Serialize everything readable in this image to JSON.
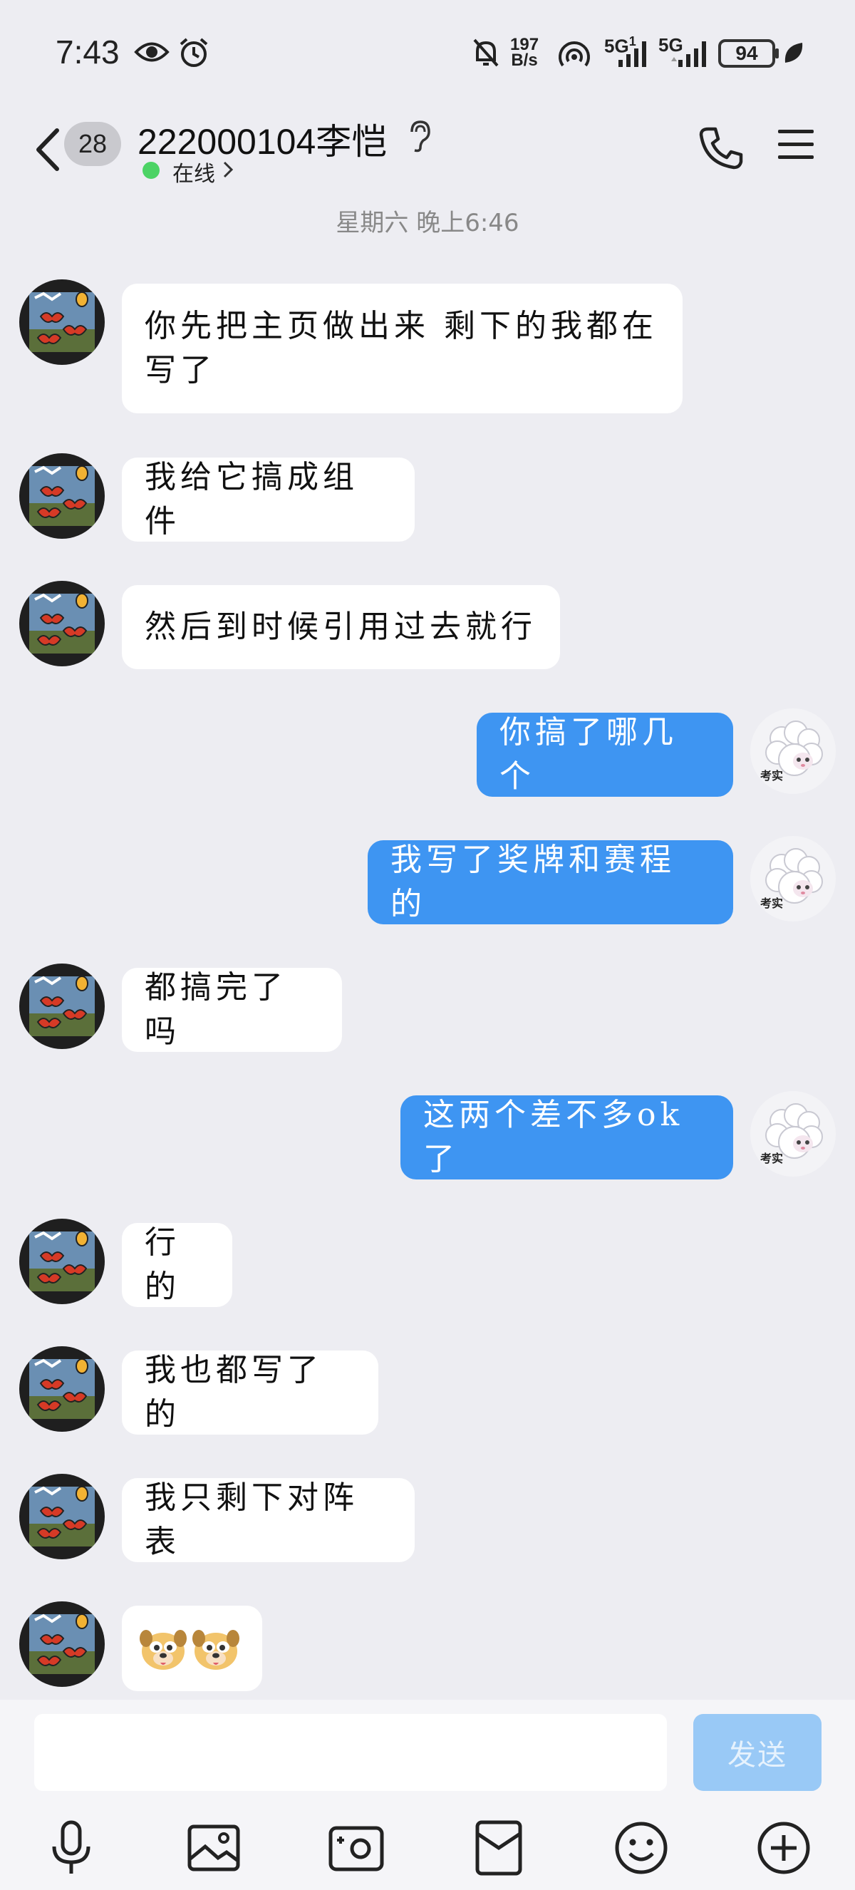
{
  "status_bar": {
    "time": "7:43",
    "net_speed_value": "197",
    "net_speed_unit": "B/s",
    "signal1_label": "5G",
    "signal1_sup": "1",
    "signal2_label": "5G",
    "battery": "94",
    "icons": [
      "eye-icon",
      "alarm-icon",
      "mute-bell-icon",
      "hotspot-icon",
      "signal-icon",
      "signal-icon",
      "battery-icon",
      "leaf-icon"
    ]
  },
  "header": {
    "unread_count": "28",
    "contact_name": "222000104李恺",
    "online_status": "在线",
    "icons": [
      "back-arrow-icon",
      "ear-icon",
      "chevron-right-icon",
      "phone-icon",
      "menu-icon"
    ]
  },
  "timestamp": "星期六 晚上6:46",
  "messages": [
    {
      "side": "in",
      "text": "你先把主页做出来 剩下的我都在写了"
    },
    {
      "side": "in",
      "text": "我给它搞成组件"
    },
    {
      "side": "in",
      "text": "然后到时候引用过去就行"
    },
    {
      "side": "out",
      "text": "你搞了哪几个"
    },
    {
      "side": "out",
      "text": "我写了奖牌和赛程的"
    },
    {
      "side": "in",
      "text": "都搞完了吗"
    },
    {
      "side": "out",
      "text": "这两个差不多ok了"
    },
    {
      "side": "in",
      "text": "行的"
    },
    {
      "side": "in",
      "text": "我也都写了的"
    },
    {
      "side": "in",
      "text": "我只剩下对阵表"
    },
    {
      "side": "in",
      "text": "",
      "sticker": "dog-face-stickers"
    }
  ],
  "my_avatar_caption": "考实",
  "input": {
    "placeholder": "",
    "send_label": "发送"
  },
  "toolbar": [
    "microphone-icon",
    "image-icon",
    "camera-icon",
    "red-packet-icon",
    "emoji-icon",
    "plus-icon"
  ],
  "colors": {
    "accent_bubble": "#3e95f2",
    "send_disabled": "#99c9f6",
    "online": "#4cd365",
    "background": "#ededf2"
  }
}
